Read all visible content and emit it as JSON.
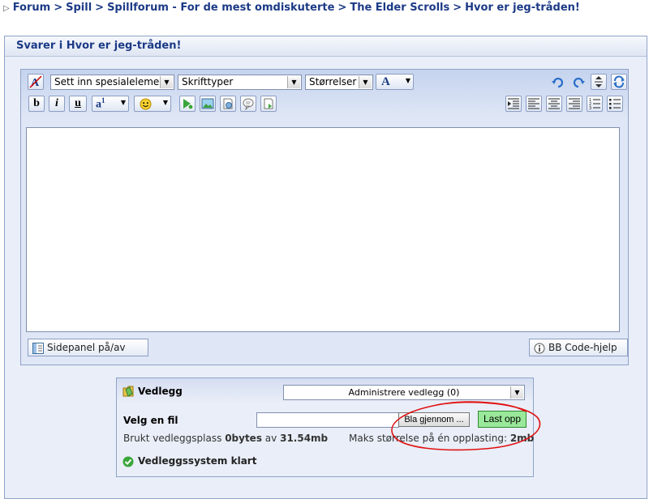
{
  "breadcrumb": {
    "items": [
      "Forum",
      "Spill",
      "Spillforum - For de mest omdiskuterte",
      "The Elder Scrolls",
      "Hvor er jeg-tråden!"
    ],
    "separator": ">"
  },
  "reply": {
    "title": "Svarer i Hvor er jeg-tråden!"
  },
  "editor": {
    "special_select": "Sett inn spesialelement",
    "font_select": "Skrifttyper",
    "size_select": "Størrelser",
    "color_letter": "A",
    "bold": "b",
    "italic": "i",
    "underline": "u",
    "sidepanel_label": "Sidepanel på/av",
    "bbcode_label": "BB Code-hjelp",
    "content": ""
  },
  "attachments": {
    "title": "Vedlegg",
    "manage_select": "Administrere vedlegg (0)",
    "choose_label": "Velg en fil",
    "file_value": "",
    "browse_label": "Bla gjennom ...",
    "upload_label": "Last opp",
    "used_prefix": "Brukt vedleggsplass",
    "used_value": "0bytes",
    "used_of": "av",
    "total_value": "31.54mb",
    "max_prefix": "Maks størrelse på én opplasting:",
    "max_value": "2mb",
    "status": "Vedleggssystem klart"
  },
  "colors": {
    "link": "#1c3a86",
    "panel_bg": "#e9eef8",
    "border": "#8fa3c8",
    "upload_bg": "#9ae89a",
    "annotation_red": "#e01010"
  }
}
